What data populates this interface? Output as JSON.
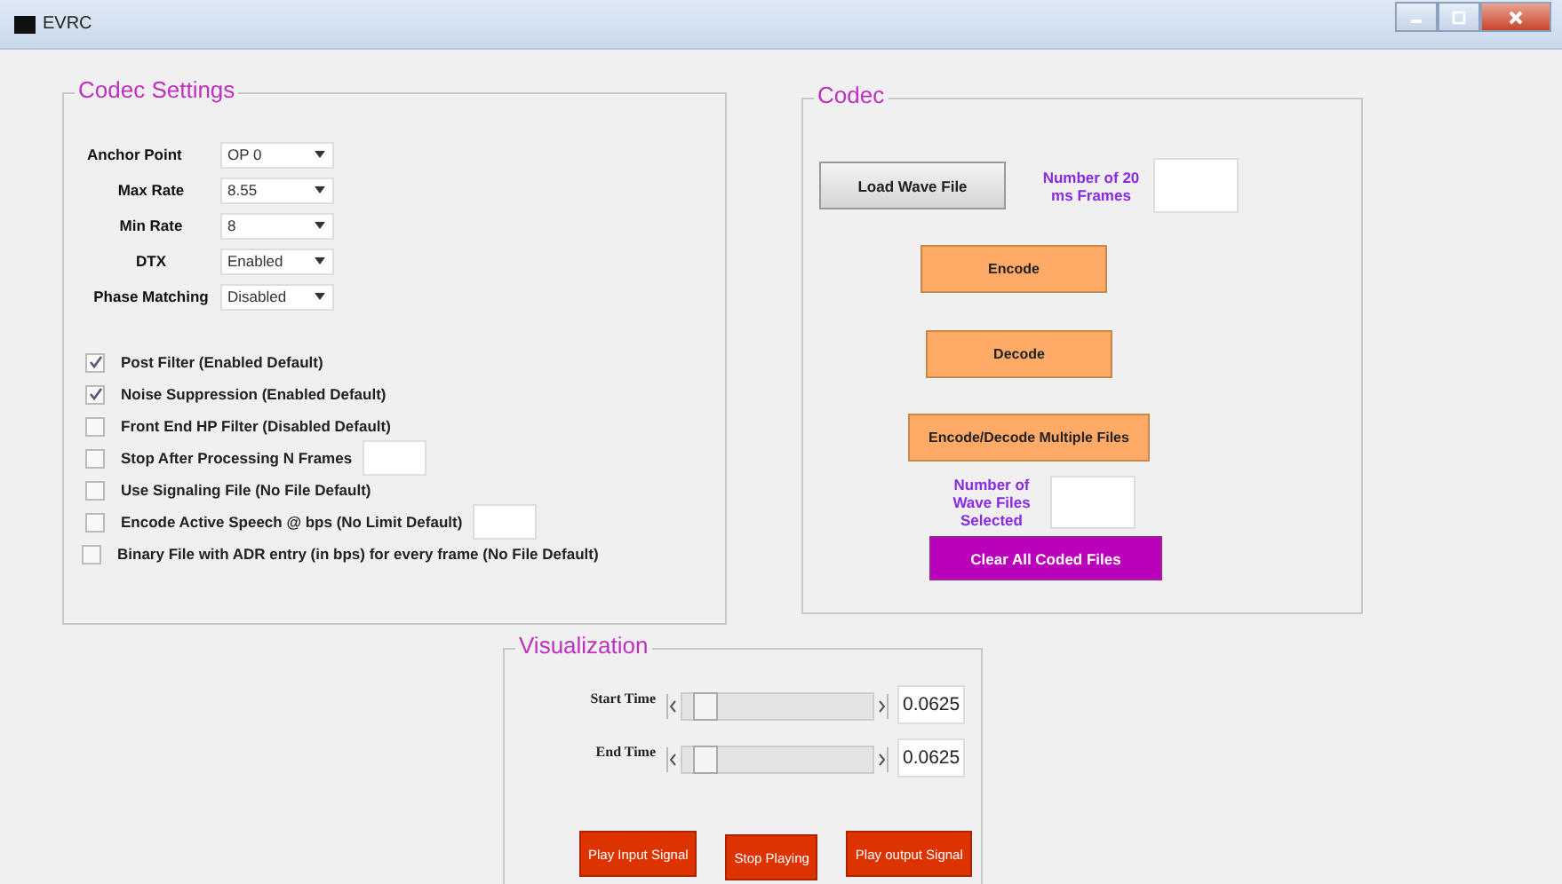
{
  "window": {
    "title": "EVRC"
  },
  "codec_settings": {
    "title": "Codec Settings",
    "dropdowns": [
      {
        "label": "Anchor Point",
        "value": "OP 0"
      },
      {
        "label": "Max Rate",
        "value": "8.55"
      },
      {
        "label": "Min Rate",
        "value": "8"
      },
      {
        "label": "DTX",
        "value": "Enabled"
      },
      {
        "label": "Phase Matching",
        "value": "Disabled"
      }
    ],
    "options": [
      {
        "kind": "checkbox",
        "label": "Post Filter (Enabled Default)",
        "checked": true
      },
      {
        "kind": "checkbox",
        "label": "Noise Suppression (Enabled Default)",
        "checked": true
      },
      {
        "kind": "checkbox",
        "label": "Front End HP Filter (Disabled Default)",
        "checked": false
      },
      {
        "kind": "checkbox-field",
        "label": "Stop After Processing N Frames",
        "checked": false
      },
      {
        "kind": "checkbox",
        "label": "Use Signaling File (No File Default)",
        "checked": false
      },
      {
        "kind": "checkbox-field",
        "label": "Encode Active Speech @ bps (No Limit Default)",
        "checked": false
      },
      {
        "kind": "checkbox",
        "label": "Binary File with ADR entry (in bps) for every frame (No File Default)",
        "checked": false
      }
    ]
  },
  "codec": {
    "title": "Codec",
    "load_button": "Load Wave File",
    "frames_label": "Number of 20 ms Frames",
    "buttons": [
      {
        "kind": "orange",
        "label": "Encode"
      },
      {
        "kind": "orange",
        "label": "Decode"
      },
      {
        "kind": "orange",
        "label": "Encode/Decode Multiple Files"
      }
    ],
    "files_label": "Number of Wave Files Selected",
    "clear_button": "Clear All Coded Files"
  },
  "visualization": {
    "title": "Visualization",
    "sliders": [
      {
        "label": "Start Time",
        "level": 0.06,
        "value": "0.0625"
      },
      {
        "label": "End Time",
        "level": 0.06,
        "value": "0.0625"
      }
    ],
    "buttons": [
      "Play Input Signal",
      "Stop Playing",
      "Play output Signal"
    ]
  }
}
